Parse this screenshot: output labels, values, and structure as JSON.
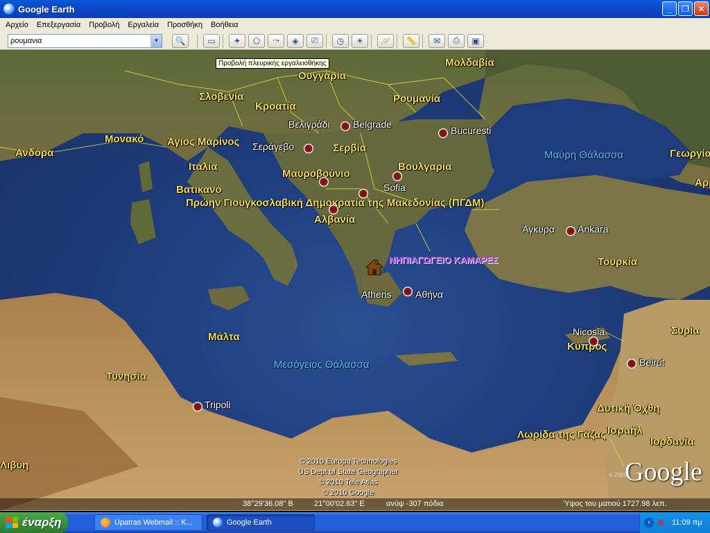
{
  "window": {
    "title": "Google Earth"
  },
  "menu": [
    "Αρχείο",
    "Επεξεργασία",
    "Προβολή",
    "Εργαλεία",
    "Προσθήκη",
    "Βοήθεια"
  ],
  "search": {
    "value": "ρουμανια"
  },
  "tooltip": "Προβολή πλευρικής εργαλειοθήκης",
  "map": {
    "countries": [
      {
        "name": "Μολδαβία"
      },
      {
        "name": "Ουγγαρία"
      },
      {
        "name": "Σλοβενία"
      },
      {
        "name": "Κροατία"
      },
      {
        "name": "Ρουμανία"
      },
      {
        "name": "Σερβία"
      },
      {
        "name": "Μονακό"
      },
      {
        "name": "Άγιος Μαρίνος"
      },
      {
        "name": "Ανδόρα"
      },
      {
        "name": "Ιταλία"
      },
      {
        "name": "Μαυροβούνιο"
      },
      {
        "name": "Βουλγαρία"
      },
      {
        "name": "Βατικανό"
      },
      {
        "name": "Πρώην Γιουγκοσλαβική Δημοκρατία της Μακεδονίας (ΠΓΔΜ)"
      },
      {
        "name": "Αλβανία"
      },
      {
        "name": "Τουρκία"
      },
      {
        "name": "Μάλτα"
      },
      {
        "name": "Κύπρος"
      },
      {
        "name": "Συρία"
      },
      {
        "name": "Τυνησία"
      },
      {
        "name": "Δυτική Όχθη"
      },
      {
        "name": "Λωρίδα της Γάζας"
      },
      {
        "name": "Ισραήλ"
      },
      {
        "name": "Ιορδανία"
      },
      {
        "name": "Γεωργία"
      },
      {
        "name": "Αρμενία"
      },
      {
        "name": "Λιβύη"
      }
    ],
    "cities": [
      {
        "name": "Βελιγράδι"
      },
      {
        "name": "Belgrade"
      },
      {
        "name": "Bucuresti"
      },
      {
        "name": "Σεράγεβο"
      },
      {
        "name": "Sofia"
      },
      {
        "name": "Άγκυρα"
      },
      {
        "name": "Ankara"
      },
      {
        "name": "Athens"
      },
      {
        "name": "Αθήνα"
      },
      {
        "name": "Nicosia"
      },
      {
        "name": "Beirut"
      },
      {
        "name": "Tripoli"
      }
    ],
    "seas": [
      {
        "name": "Μαύρη Θάλασσα"
      },
      {
        "name": "Μεσόγειος Θάλασσα"
      }
    ],
    "placemark": "ΝΗΠΙΑΓΩΓΕΙΟ ΚΑΜΑΡΕΣ",
    "copyright_lines": [
      "© 2010 Europa Technologies",
      "US Dept of State Geographer",
      "© 2010 Tele Atlas",
      "© 2010 Google"
    ],
    "logo": "Google",
    "logo_year": "© 2009"
  },
  "status": {
    "lat": "38°29'36.08\" B",
    "lon": "21°00'02.63\" E",
    "elev": "ανύψ -307 πόδια",
    "eye": "Ύψος του ματιού  1727.98 λεπ."
  },
  "taskbar": {
    "start": "έναρξη",
    "tasks": [
      "Upatras Webmail :: K...",
      "Google Earth"
    ],
    "clock": "11:09 πμ"
  }
}
